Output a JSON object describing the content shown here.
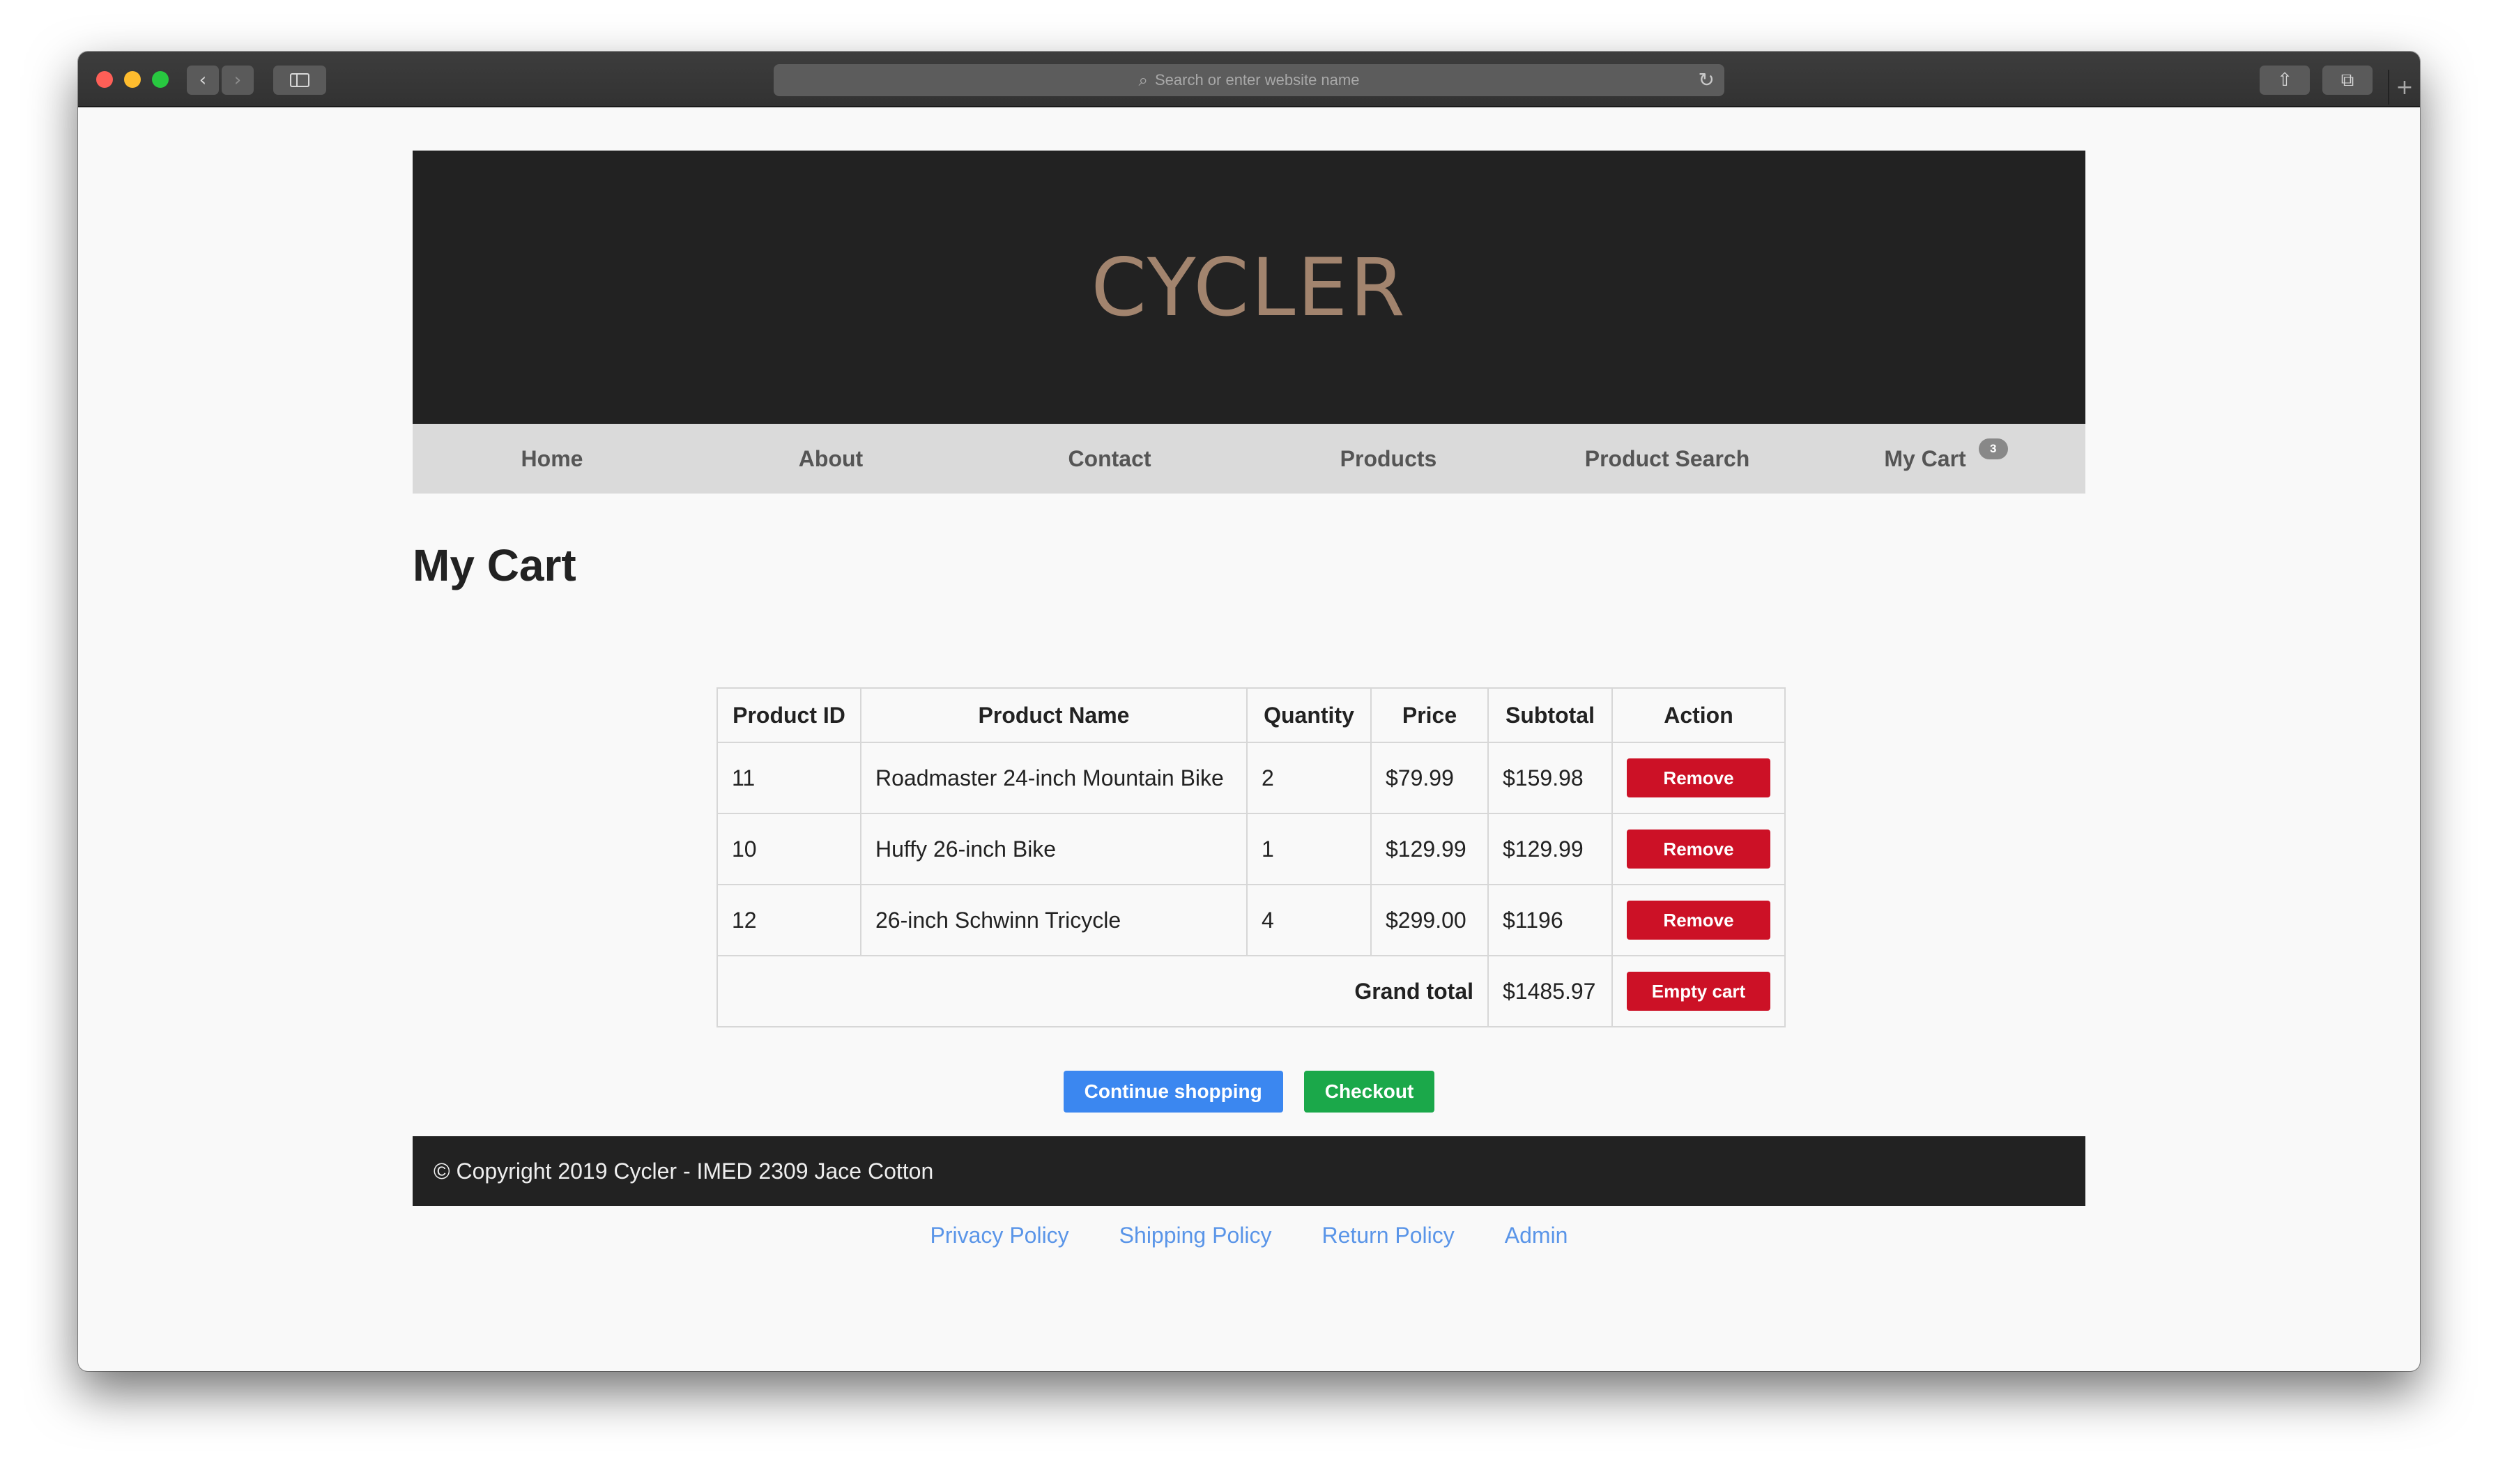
{
  "browser": {
    "address_placeholder": "Search or enter website name"
  },
  "site": {
    "logo": "CYCLER",
    "nav": [
      "Home",
      "About",
      "Contact",
      "Products",
      "Product Search",
      "My Cart"
    ],
    "cart_count": "3"
  },
  "page": {
    "title": "My Cart"
  },
  "cart": {
    "headers": [
      "Product ID",
      "Product Name",
      "Quantity",
      "Price",
      "Subtotal",
      "Action"
    ],
    "rows": [
      {
        "id": "11",
        "name": "Roadmaster 24-inch Mountain Bike",
        "qty": "2",
        "price": "$79.99",
        "subtotal": "$159.98",
        "action": "Remove"
      },
      {
        "id": "10",
        "name": "Huffy 26-inch Bike",
        "qty": "1",
        "price": "$129.99",
        "subtotal": "$129.99",
        "action": "Remove"
      },
      {
        "id": "12",
        "name": "26-inch Schwinn Tricycle",
        "qty": "4",
        "price": "$299.00",
        "subtotal": "$1196",
        "action": "Remove"
      }
    ],
    "grand_total_label": "Grand total",
    "grand_total": "$1485.97",
    "empty_label": "Empty cart"
  },
  "buttons": {
    "continue": "Continue shopping",
    "checkout": "Checkout"
  },
  "footer": {
    "copyright": "© Copyright 2019 Cycler - IMED 2309 Jace Cotton",
    "links": [
      "Privacy Policy",
      "Shipping Policy",
      "Return Policy",
      "Admin"
    ]
  },
  "colors": {
    "hero_bg": "#222222",
    "logo": "#a2846e",
    "nav_bg": "#dadada",
    "danger": "#cc1126",
    "primary": "#3b87f0",
    "success": "#1ba84a",
    "link": "#5a95e8"
  },
  "icons": [
    "back-icon",
    "forward-icon",
    "sidebar-icon",
    "search-icon",
    "reload-icon",
    "share-icon",
    "tabs-icon",
    "new-tab-icon"
  ]
}
